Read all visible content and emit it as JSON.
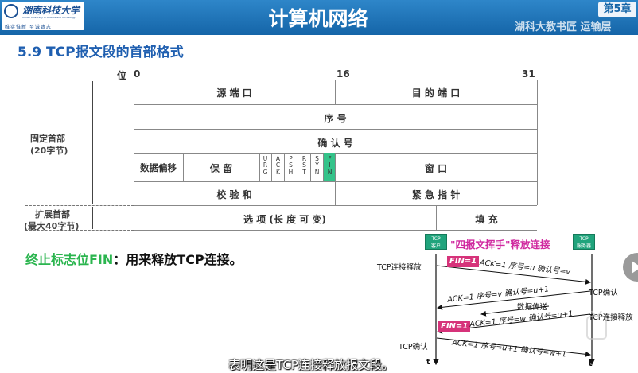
{
  "header": {
    "logo_name": "湖南科技大学",
    "logo_subtitle": "Hunan University of Science and Technology",
    "logo_motto": "唯实惟新  至诚致志",
    "title": "计算机网络",
    "chapter": "第5章",
    "watermark": "湖科大教书匠 运输层"
  },
  "section_title": "5.9 TCP报文段的首部格式",
  "table": {
    "bit_label": "位",
    "bit_0": "0",
    "bit_16": "16",
    "bit_31": "31",
    "src_port": "源 端 口",
    "dst_port": "目 的 端 口",
    "seq": "序 号",
    "ack_num": "确 认 号",
    "data_offset": "数据偏移",
    "reserved": "保 留",
    "flags": [
      "URG",
      "ACK",
      "PSH",
      "RST",
      "SYN",
      "FIN"
    ],
    "window": "窗 口",
    "checksum": "校 验 和",
    "urgent_ptr": "紧 急 指 针",
    "options": "选 项 (长 度 可 变)",
    "padding": "填 充",
    "fixed_header": "固定首部",
    "fixed_header_size": "(20字节)",
    "ext_header": "扩展首部",
    "ext_header_size": "(最大40字节)"
  },
  "fin_note": {
    "term": "终止标志位FIN",
    "desc": "：用来释放TCP连接。"
  },
  "diagram": {
    "title": "\"四报文挥手\"释放连接",
    "client": [
      "TCP",
      "客户"
    ],
    "server": [
      "TCP",
      "服务器"
    ],
    "client_release": "TCP连接释放",
    "server_ack": "TCP确认",
    "data_transfer": "数据传送",
    "server_release": "TCP连接释放",
    "client_ack": "TCP确认",
    "fin_label": "FIN=1",
    "msg1": "ACK=1  序号=u  确认号=v",
    "msg2": "ACK=1  序号=v  确认号=u+1",
    "msg3": "ACK=1  序号=w  确认号=u+1",
    "msg4": "ACK=1  序号=u+1  确认号=w+1",
    "time_left": "t",
    "time_right": "t"
  },
  "subtitle": "表明这是TCP连接释放报文段。",
  "colors": {
    "header_blue": "#1565a8",
    "fin_green": "#34c38a",
    "fin_pink": "#d6337a",
    "note_green": "#2bb54f"
  }
}
